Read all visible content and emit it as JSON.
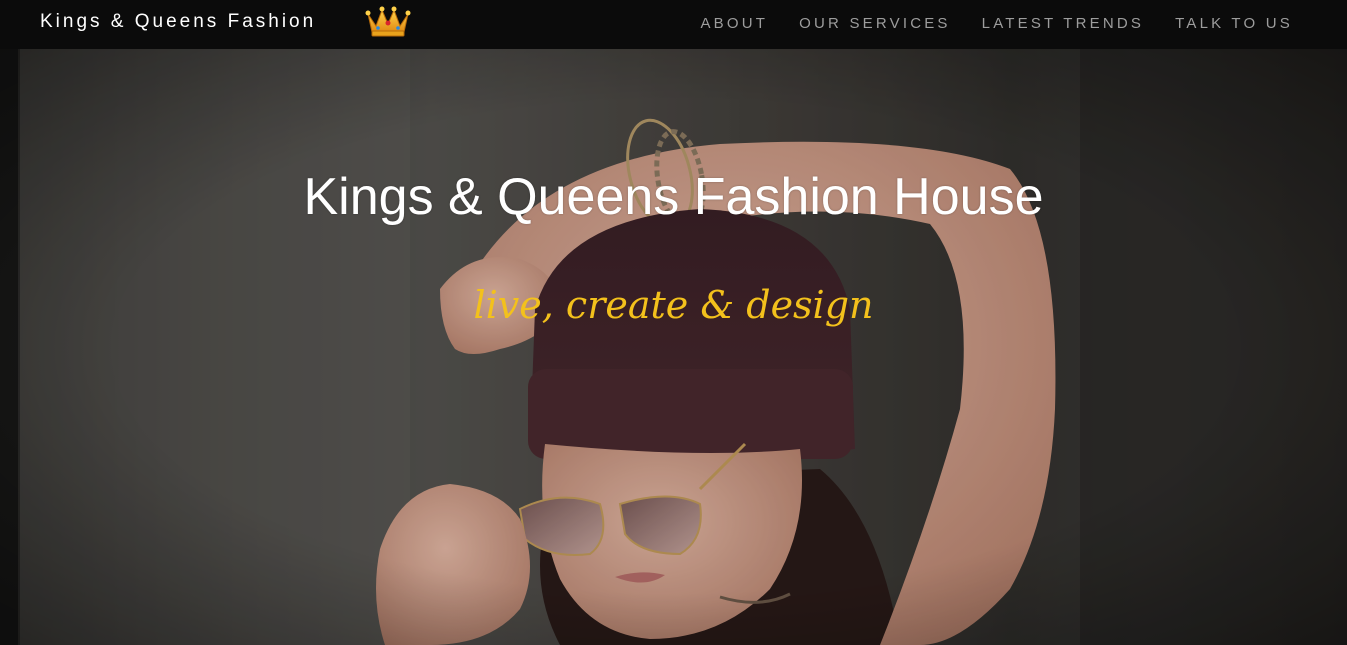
{
  "navbar": {
    "brand": "Kings & Queens Fashion",
    "brand_icon": "crown-icon",
    "links": [
      {
        "label": "ABOUT"
      },
      {
        "label": "OUR SERVICES"
      },
      {
        "label": "LATEST TRENDS"
      },
      {
        "label": "TALK TO US"
      }
    ]
  },
  "hero": {
    "title": "Kings & Queens Fashion House",
    "tagline": "live, create & design",
    "image": "woman-in-beanie-with-sunglasses-photo"
  },
  "colors": {
    "navbar_bg": "#0b0b0b",
    "nav_link": "#9d9d9d",
    "tagline": "#f3c11c",
    "title": "#ffffff"
  }
}
